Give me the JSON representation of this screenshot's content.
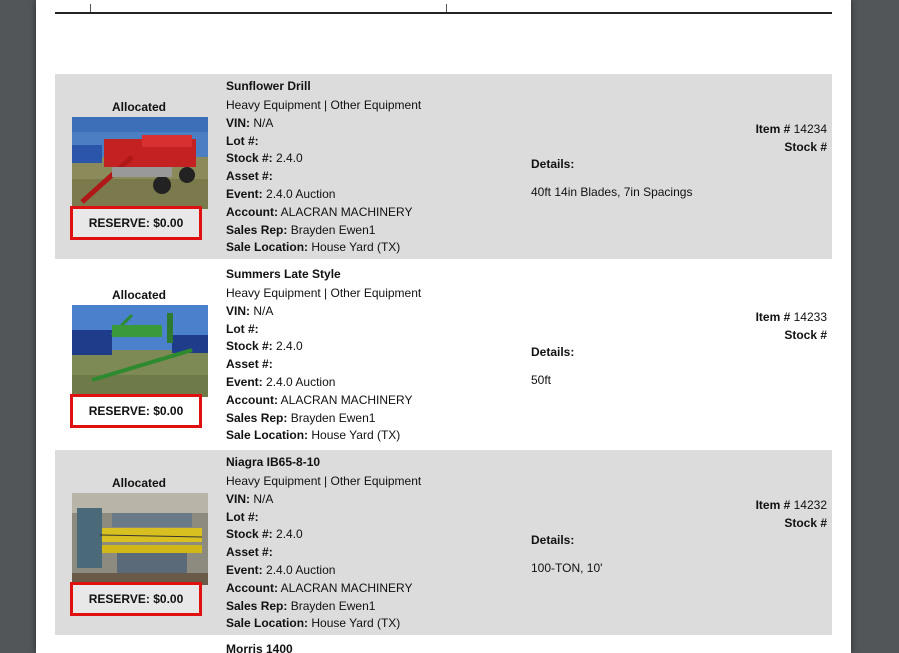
{
  "rows": [
    {
      "status": "Allocated",
      "title": "Sunflower Drill",
      "category": "Heavy Equipment | Other Equipment",
      "vin_label": "VIN:",
      "vin": "N/A",
      "lot_label": "Lot #:",
      "lot": "",
      "stock_label": "Stock #:",
      "stock": "2.4.0",
      "asset_label": "Asset #:",
      "asset": "",
      "event_label": "Event:",
      "event": "2.4.0 Auction",
      "account_label": "Account:",
      "account": "ALACRAN MACHINERY",
      "rep_label": "Sales Rep:",
      "rep": "Brayden Ewen1",
      "loc_label": "Sale Location:",
      "loc": "House Yard (TX)",
      "details_label": "Details:",
      "details": "40ft 14in Blades, 7in Spacings",
      "item_label": "Item #",
      "item": "14234",
      "stock_no_label": "Stock #",
      "reserve": "RESERVE: $0.00"
    },
    {
      "status": "Allocated",
      "title": "Summers Late Style",
      "category": "Heavy Equipment | Other Equipment",
      "vin_label": "VIN:",
      "vin": "N/A",
      "lot_label": "Lot #:",
      "lot": "",
      "stock_label": "Stock #:",
      "stock": "2.4.0",
      "asset_label": "Asset #:",
      "asset": "",
      "event_label": "Event:",
      "event": "2.4.0 Auction",
      "account_label": "Account:",
      "account": "ALACRAN MACHINERY",
      "rep_label": "Sales Rep:",
      "rep": "Brayden Ewen1",
      "loc_label": "Sale Location:",
      "loc": "House Yard (TX)",
      "details_label": "Details:",
      "details": "50ft",
      "item_label": "Item #",
      "item": "14233",
      "stock_no_label": "Stock #",
      "reserve": "RESERVE: $0.00"
    },
    {
      "status": "Allocated",
      "title": "Niagra IB65-8-10",
      "category": "Heavy Equipment | Other Equipment",
      "vin_label": "VIN:",
      "vin": "N/A",
      "lot_label": "Lot #:",
      "lot": "",
      "stock_label": "Stock #:",
      "stock": "2.4.0",
      "asset_label": "Asset #:",
      "asset": "",
      "event_label": "Event:",
      "event": "2.4.0 Auction",
      "account_label": "Account:",
      "account": "ALACRAN MACHINERY",
      "rep_label": "Sales Rep:",
      "rep": "Brayden Ewen1",
      "loc_label": "Sale Location:",
      "loc": "House Yard (TX)",
      "details_label": "Details:",
      "details": "100-TON, 10'",
      "item_label": "Item #",
      "item": "14232",
      "stock_no_label": "Stock #",
      "reserve": "RESERVE: $0.00"
    }
  ],
  "next_title": "Morris 1400",
  "colors": {
    "reserve_border": "#e01010",
    "row_shade": "#dcdcdc",
    "viewer_bg": "#525659"
  }
}
